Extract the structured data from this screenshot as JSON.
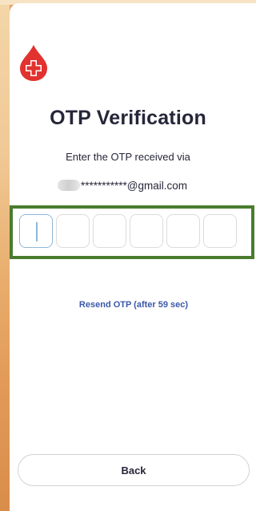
{
  "header": {
    "logo_icon": "blood-drop-cross-icon",
    "title": "OTP Verification"
  },
  "verification": {
    "instruction": "Enter the OTP received via",
    "masked_email": "***********@gmail.com"
  },
  "otp": {
    "digits": [
      "",
      "",
      "",
      "",
      "",
      ""
    ],
    "active_index": 0
  },
  "resend": {
    "label": "Resend OTP (after 59 sec)"
  },
  "footer": {
    "back_label": "Back"
  },
  "colors": {
    "brand_red": "#e2322f",
    "text_dark": "#26263a",
    "link_blue": "#3a58a8",
    "highlight_green": "#4a7c2f",
    "focus_blue": "#8fb8d8"
  }
}
